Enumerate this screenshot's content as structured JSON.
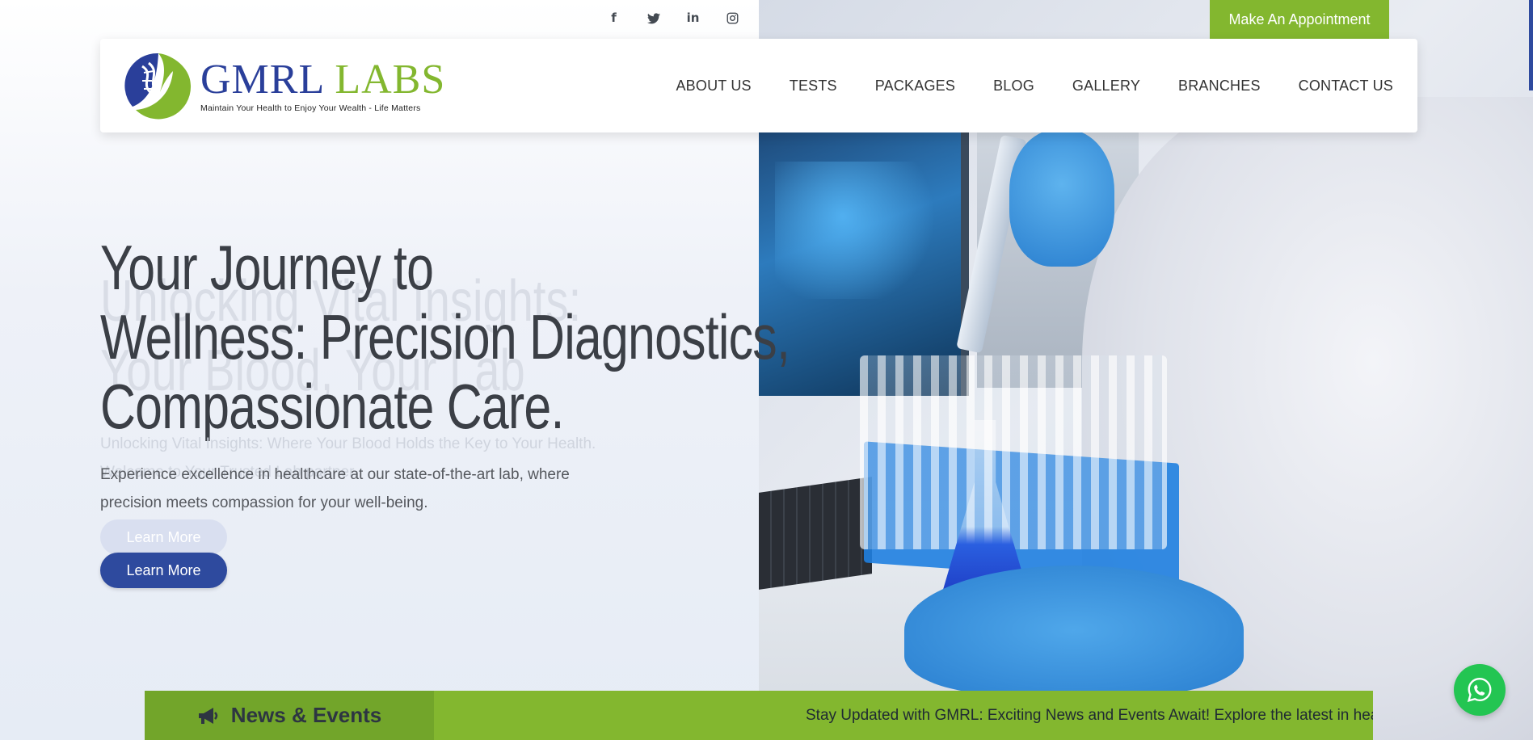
{
  "topbar": {
    "social": [
      {
        "icon": "facebook-icon",
        "glyph": "f"
      },
      {
        "icon": "twitter-icon",
        "glyph": "🐦"
      },
      {
        "icon": "linkedin-icon",
        "glyph": "in"
      },
      {
        "icon": "instagram-icon",
        "glyph": "◎"
      }
    ],
    "appointment_label": "Make An Appointment"
  },
  "header": {
    "logo": {
      "name_part1": "GMRL",
      "name_part2": "LABS",
      "tagline": "Maintain Your Health to Enjoy Your Wealth - Life Matters"
    },
    "nav": [
      "ABOUT US",
      "TESTS",
      "PACKAGES",
      "BLOG",
      "GALLERY",
      "BRANCHES",
      "CONTACT US"
    ]
  },
  "hero": {
    "ghost_title": "Unlocking Vital Insights: Your Blood, Your Lab",
    "title_line1": "Your Journey to",
    "title_line2": "Wellness: Precision Diagnostics,",
    "title_line3": "Compassionate Care.",
    "ghost_subtitle": "Unlocking Vital Insights: Where Your Blood Holds the Key to Your Health. Welcome to Your Trusted Lab partner.",
    "subtitle": "Experience excellence in healthcare at our state-of-the-art lab, where precision meets compassion for your well-being.",
    "ghost_button": "Learn More",
    "button": "Learn More"
  },
  "news": {
    "label": "News & Events",
    "ticker": "Stay Updated with GMRL: Exciting News and Events Await! Explore the latest in health breakthroughs, special offers, and upcoming events."
  },
  "colors": {
    "brand_blue": "#2e4a9e",
    "brand_green": "#83b72f",
    "whatsapp_green": "#23c552"
  }
}
